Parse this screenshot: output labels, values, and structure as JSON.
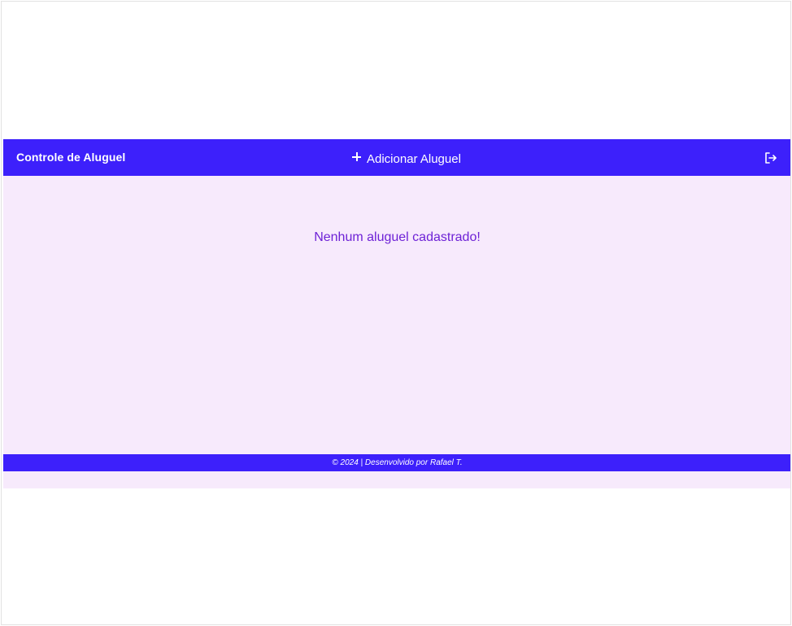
{
  "header": {
    "title": "Controle de Aluguel",
    "add_label": "Adicionar Aluguel",
    "add_icon": "plus-icon",
    "logout_icon": "logout-icon"
  },
  "main": {
    "empty_message": "Nenhum aluguel cadastrado!"
  },
  "footer": {
    "text": "© 2024 | Desenvolvido por Rafael T."
  },
  "colors": {
    "primary": "#3d20fb",
    "background": "#f7eafc",
    "message": "#6e22d6"
  }
}
